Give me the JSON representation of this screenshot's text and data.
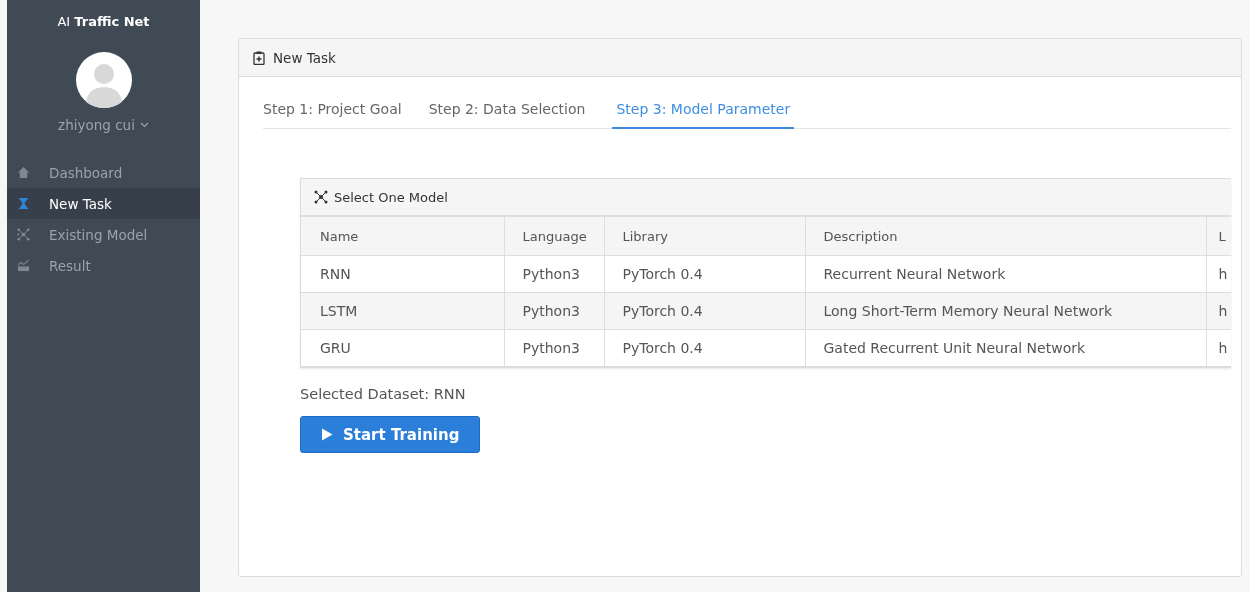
{
  "sidebar": {
    "brand_prefix": "AI",
    "brand": "Traffic Net",
    "user": "zhiyong cui",
    "items": [
      {
        "label": "Dashboard",
        "kind": "home",
        "selected": false
      },
      {
        "label": "New Task",
        "kind": "hourglass",
        "selected": true
      },
      {
        "label": "Existing Model",
        "kind": "network",
        "selected": false
      },
      {
        "label": "Result",
        "kind": "chart",
        "selected": false
      }
    ]
  },
  "panel": {
    "title": "New Task",
    "tabs": [
      {
        "label": "Step 1: Project Goal",
        "selected": false
      },
      {
        "label": "Step 2: Data Selection",
        "selected": false
      },
      {
        "label": "Step 3: Model Parameter",
        "selected": true
      }
    ],
    "table": {
      "title": "Select One Model",
      "columns": [
        "Name",
        "Language",
        "Library",
        "Description",
        "L"
      ],
      "rows": [
        [
          "RNN",
          "Python3",
          "PyTorch 0.4",
          "Recurrent Neural Network",
          "h"
        ],
        [
          "LSTM",
          "Python3",
          "PyTorch 0.4",
          "Long Short-Term Memory Neural Network",
          "h"
        ],
        [
          "GRU",
          "Python3",
          "PyTorch 0.4",
          "Gated Recurrent Unit Neural Network",
          "h"
        ]
      ]
    },
    "selected_text": "Selected Dataset: RNN",
    "button": "Start Training"
  }
}
